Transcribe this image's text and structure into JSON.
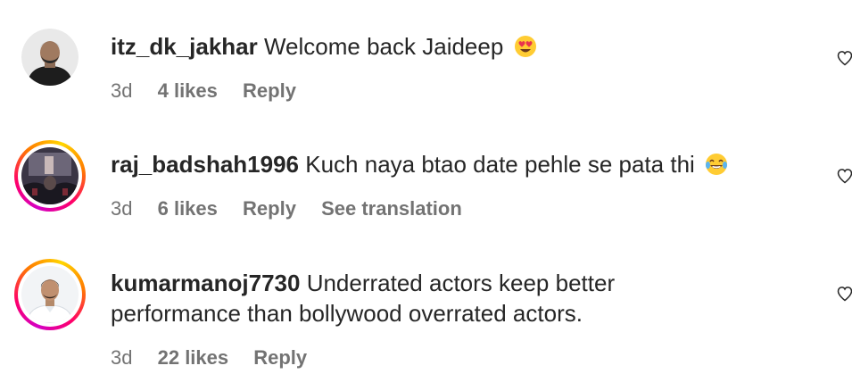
{
  "comments": [
    {
      "username": "itz_dk_jakhar",
      "text": "Welcome back Jaideep",
      "emoji": "heart-eyes",
      "time": "3d",
      "likes": "4 likes",
      "reply": "Reply",
      "translate": ""
    },
    {
      "username": "raj_badshah1996",
      "text": "Kuch naya btao date pehle se pata thi",
      "emoji": "tears-of-joy",
      "time": "3d",
      "likes": "6 likes",
      "reply": "Reply",
      "translate": "See translation"
    },
    {
      "username": "kumarmanoj7730",
      "text_line1": "Underrated actors keep better",
      "text_line2": "performance than bollywood overrated actors.",
      "time": "3d",
      "likes": "22 likes",
      "reply": "Reply"
    }
  ],
  "colors": {
    "text": "#262626",
    "meta": "#737373",
    "ring_start": "#d300c5",
    "ring_mid": "#ff0069",
    "ring_end": "#ffd600"
  },
  "icons": [
    "heart-outline-icon",
    "heart-eyes-emoji",
    "tears-of-joy-emoji"
  ]
}
